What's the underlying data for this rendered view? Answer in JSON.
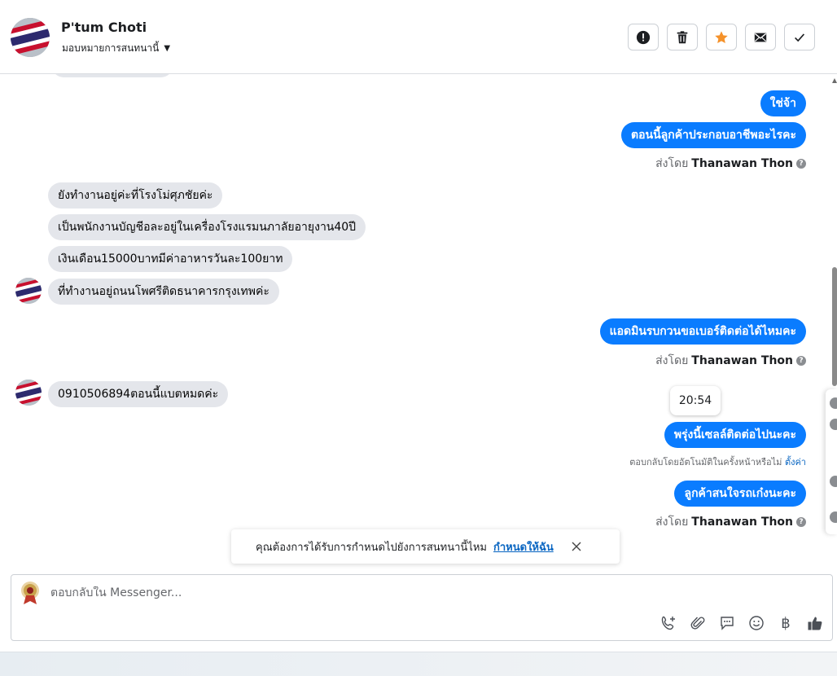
{
  "header": {
    "contact_name": "P'tum Choti",
    "assign_label": "มอบหมายการสนทนานี้",
    "actions": [
      "report-spam",
      "delete",
      "star",
      "email",
      "mark-done"
    ]
  },
  "messages": {
    "incoming": [
      "ยังทำงานอยู่ค่ะที่โรงโม่ศุภชัยค่ะ",
      "เป็นพนักงานบัญชีอละอยู่ในเครื่องโรงแรมนภาลัยอายุงาน40ปี",
      "เงินเดือน15000บาทมีค่าอาหารวันละ100ยาท",
      "ที่ทำงานอยู่ถนนโพศรีติดธนาคารกรุงเทพค่ะ",
      "0910506894ตอนนี้แบตหมดค่ะ"
    ],
    "outgoing": [
      "ใช่จ้า",
      "ตอนนี้ลูกค้าประกอบอาชีพอะไรคะ",
      "แอดมินรบกวนขอเบอร์ติดต่อได้ไหมคะ",
      "พรุ่งนี้เซลล์ติดต่อไปนะคะ",
      "ลูกค้าสนใจรถเก๋งนะคะ"
    ],
    "sent_by_prefix": "ส่งโดย",
    "sent_by_name": "Thanawan Thon",
    "help_glyph": "?",
    "time_chip": "20:54",
    "auto_reply_text": "ตอบกลับโดยอัตโนมัติในครั้งหน้าหรือไม่",
    "auto_reply_link": "ตั้งค่า"
  },
  "toast": {
    "text": "คุณต้องการได้รับการกำหนดไปยังการสนทนานี้ไหม",
    "link": "กำหนดให้ฉัน"
  },
  "composer": {
    "placeholder": "ตอบกลับใน Messenger...",
    "tools": [
      "call-add-icon",
      "attach-icon",
      "saved-reply-icon",
      "emoji-icon",
      "baht-icon",
      "thumbs-up-icon"
    ],
    "baht_glyph": "฿"
  },
  "colors": {
    "outgoing_bubble": "#0a7cff",
    "incoming_bubble": "#e4e6eb",
    "star": "#f5922a",
    "link": "#0a66c2"
  }
}
